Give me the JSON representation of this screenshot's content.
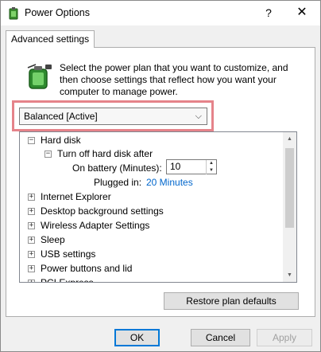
{
  "window": {
    "title": "Power Options",
    "help_glyph": "?",
    "close_glyph": "✕"
  },
  "tabs": [
    {
      "label": "Advanced settings"
    }
  ],
  "intro": {
    "text": "Select the power plan that you want to customize, and then choose settings that reflect how you want your computer to manage power."
  },
  "plan_select": {
    "selected": "Balanced [Active]"
  },
  "tree": {
    "hard_disk": {
      "expander": "−",
      "label": "Hard disk"
    },
    "turn_off": {
      "expander": "−",
      "label": "Turn off hard disk after"
    },
    "on_battery": {
      "label": "On battery (Minutes):",
      "value": "10"
    },
    "plugged_in": {
      "label": "Plugged in:",
      "value": "20 Minutes"
    },
    "items": [
      {
        "expander": "+",
        "label": "Internet Explorer"
      },
      {
        "expander": "+",
        "label": "Desktop background settings"
      },
      {
        "expander": "+",
        "label": "Wireless Adapter Settings"
      },
      {
        "expander": "+",
        "label": "Sleep"
      },
      {
        "expander": "+",
        "label": "USB settings"
      },
      {
        "expander": "+",
        "label": "Power buttons and lid"
      },
      {
        "expander": "+",
        "label": "PCI Express"
      }
    ]
  },
  "buttons": {
    "restore": "Restore plan defaults",
    "ok": "OK",
    "cancel": "Cancel",
    "apply": "Apply"
  },
  "colors": {
    "highlight": "#e5838a",
    "link": "#0066cc",
    "accent": "#0078d7"
  },
  "icons": {
    "app": "power-options-icon",
    "battery": "battery-plug-icon"
  }
}
